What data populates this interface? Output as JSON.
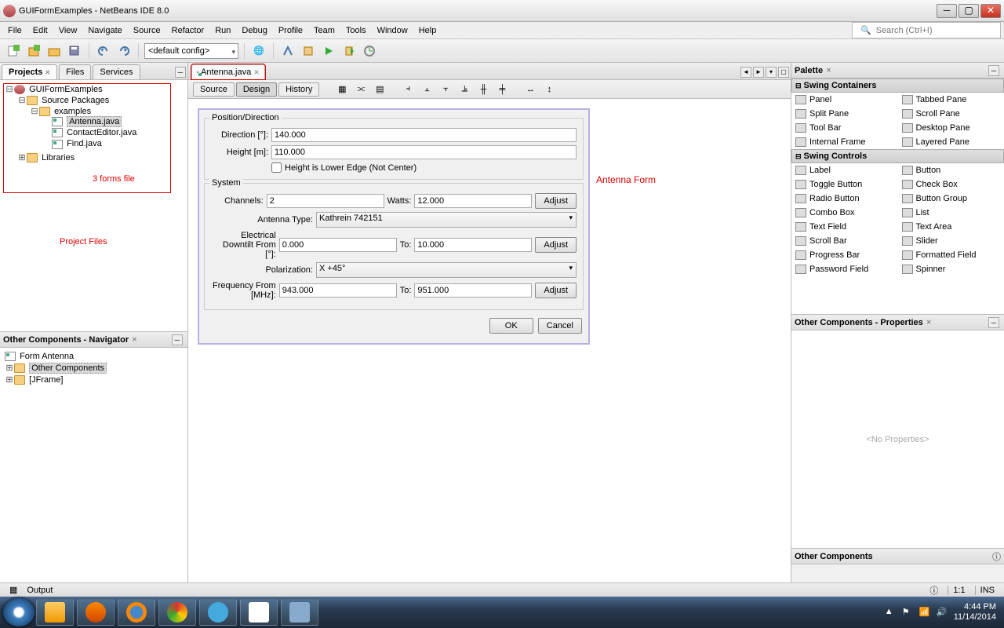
{
  "window": {
    "title": "GUIFormExamples - NetBeans IDE 8.0"
  },
  "menu": [
    "File",
    "Edit",
    "View",
    "Navigate",
    "Source",
    "Refactor",
    "Run",
    "Debug",
    "Profile",
    "Team",
    "Tools",
    "Window",
    "Help"
  ],
  "search_placeholder": "Search (Ctrl+I)",
  "toolbar_combo": "<default config>",
  "left_tabs": {
    "projects": "Projects",
    "files": "Files",
    "services": "Services"
  },
  "tree": {
    "root": "GUIFormExamples",
    "srcpkg": "Source Packages",
    "pkg": "examples",
    "files": [
      "Antenna.java",
      "ContactEditor.java",
      "Find.java"
    ],
    "libs": "Libraries"
  },
  "annot": {
    "forms": "3 forms file",
    "projfiles": "Project Files",
    "antenna": "Antenna Form"
  },
  "navigator": {
    "title": "Other Components - Navigator",
    "root": "Form Antenna",
    "items": [
      "Other Components",
      "[JFrame]"
    ]
  },
  "editor": {
    "tab": "Antenna.java",
    "modes": {
      "source": "Source",
      "design": "Design",
      "history": "History"
    }
  },
  "form": {
    "grp_pos": "Position/Direction",
    "lbl_dir": "Direction [°]:",
    "val_dir": "140.000",
    "lbl_height": "Height [m]:",
    "val_height": "110.000",
    "chk_lower": "Height is Lower Edge (Not Center)",
    "grp_sys": "System",
    "lbl_chan": "Channels:",
    "val_chan": "2",
    "lbl_watts": "Watts:",
    "val_watts": "12.000",
    "btn_adjust": "Adjust",
    "lbl_ant": "Antenna Type:",
    "val_ant": "Kathrein 742151",
    "lbl_edown": "Electrical Downtilt From [°]:",
    "val_edown_a": "0.000",
    "lbl_to": "To:",
    "val_edown_b": "10.000",
    "lbl_pol": "Polarization:",
    "val_pol": "X +45°",
    "lbl_freq": "Frequency From [MHz]:",
    "val_freq_a": "943.000",
    "val_freq_b": "951.000",
    "btn_ok": "OK",
    "btn_cancel": "Cancel"
  },
  "palette": {
    "title": "Palette",
    "cat_containers": "Swing Containers",
    "containers": [
      "Panel",
      "Tabbed Pane",
      "Split Pane",
      "Scroll Pane",
      "Tool Bar",
      "Desktop Pane",
      "Internal Frame",
      "Layered Pane"
    ],
    "cat_controls": "Swing Controls",
    "controls": [
      "Label",
      "Button",
      "Toggle Button",
      "Check Box",
      "Radio Button",
      "Button Group",
      "Combo Box",
      "List",
      "Text Field",
      "Text Area",
      "Scroll Bar",
      "Slider",
      "Progress Bar",
      "Formatted Field",
      "Password Field",
      "Spinner"
    ]
  },
  "properties": {
    "title": "Other Components - Properties",
    "empty": "<No Properties>"
  },
  "other": {
    "title": "Other Components"
  },
  "status": {
    "output": "Output",
    "pos": "1:1",
    "ins": "INS"
  },
  "tray": {
    "time": "4:44 PM",
    "date": "11/14/2014"
  }
}
